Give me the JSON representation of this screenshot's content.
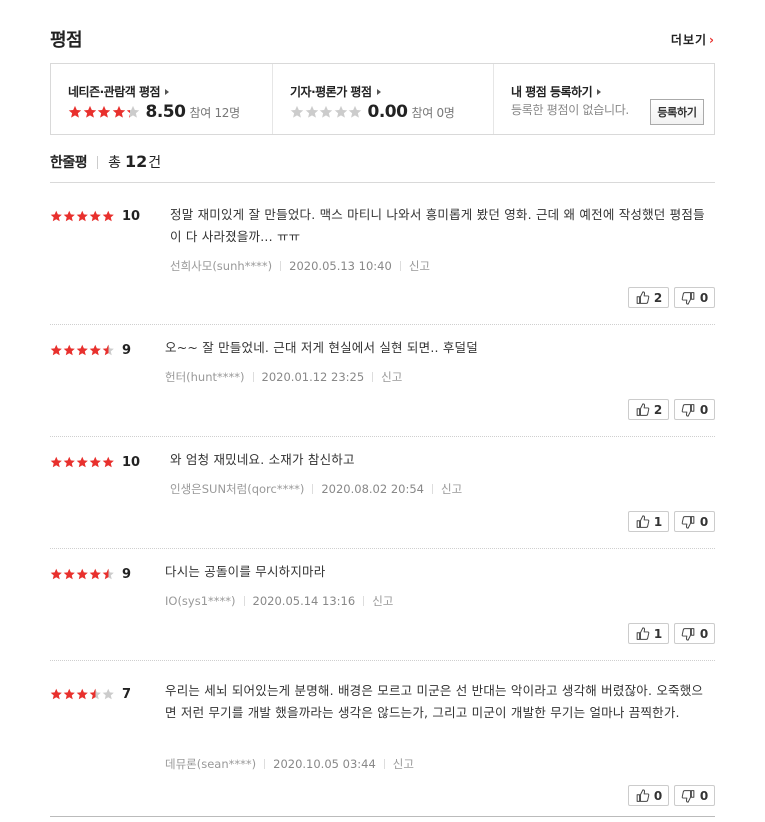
{
  "page": {
    "title": "평점",
    "more_label": "더보기",
    "more_chevron": "›"
  },
  "summary": {
    "netizen": {
      "label": "네티즌·관람객 평점",
      "score": "8.50",
      "rating_out_of_5": 4.25,
      "participants": "참여 12명"
    },
    "critic": {
      "label": "기자·평론가 평점",
      "score": "0.00",
      "rating_out_of_5": 0,
      "participants": "참여 0명"
    },
    "mine": {
      "label": "내 평점 등록하기",
      "text": "등록한 평점이 없습니다.",
      "button": "등록하기"
    }
  },
  "count": {
    "label": "한줄평",
    "prefix": "총",
    "number": "12",
    "suffix": "건"
  },
  "colors": {
    "star_on": "#e8302d",
    "star_off": "#cccccc",
    "accent": "#e8302d"
  },
  "reviews": [
    {
      "stars": 5,
      "score": "10",
      "text": "정말 재미있게 잘 만들었다. 맥스 마티니 나와서 흥미롭게 봤던 영화. 근데 왜 예전에 작성했던 평점들이 다 사라졌을까... ㅠㅠ",
      "author": "선희사모(sunh****)",
      "date": "2020.05.13 10:40",
      "report": "신고",
      "likes": "2",
      "dislikes": "0"
    },
    {
      "stars": 4.5,
      "score": "9",
      "text": "오~~ 잘 만들었네. 근대 저게 현실에서 실현 되면.. 후덜덜",
      "author": "헌터(hunt****)",
      "date": "2020.01.12 23:25",
      "report": "신고",
      "likes": "2",
      "dislikes": "0"
    },
    {
      "stars": 5,
      "score": "10",
      "text": "와 엄청 재밌네요. 소재가 참신하고",
      "author": "인생은SUN처럼(qorc****)",
      "date": "2020.08.02 20:54",
      "report": "신고",
      "likes": "1",
      "dislikes": "0"
    },
    {
      "stars": 4.5,
      "score": "9",
      "text": "다시는 공돌이를 무시하지마라",
      "author": "IO(sys1****)",
      "date": "2020.05.14 13:16",
      "report": "신고",
      "likes": "1",
      "dislikes": "0"
    },
    {
      "stars": 3.5,
      "score": "7",
      "text": "우리는 세뇌 되어있는게 분명해. 배경은 모르고 미군은 선 반대는 악이라고 생각해 버렸잖아. 오죽했으면 저런 무기를 개발 했을까라는 생각은 않드는가, 그리고 미군이 개발한 무기는 얼마나 끔찍한가.",
      "author": "데뮤론(sean****)",
      "date": "2020.10.05 03:44",
      "report": "신고",
      "likes": "0",
      "dislikes": "0"
    }
  ]
}
